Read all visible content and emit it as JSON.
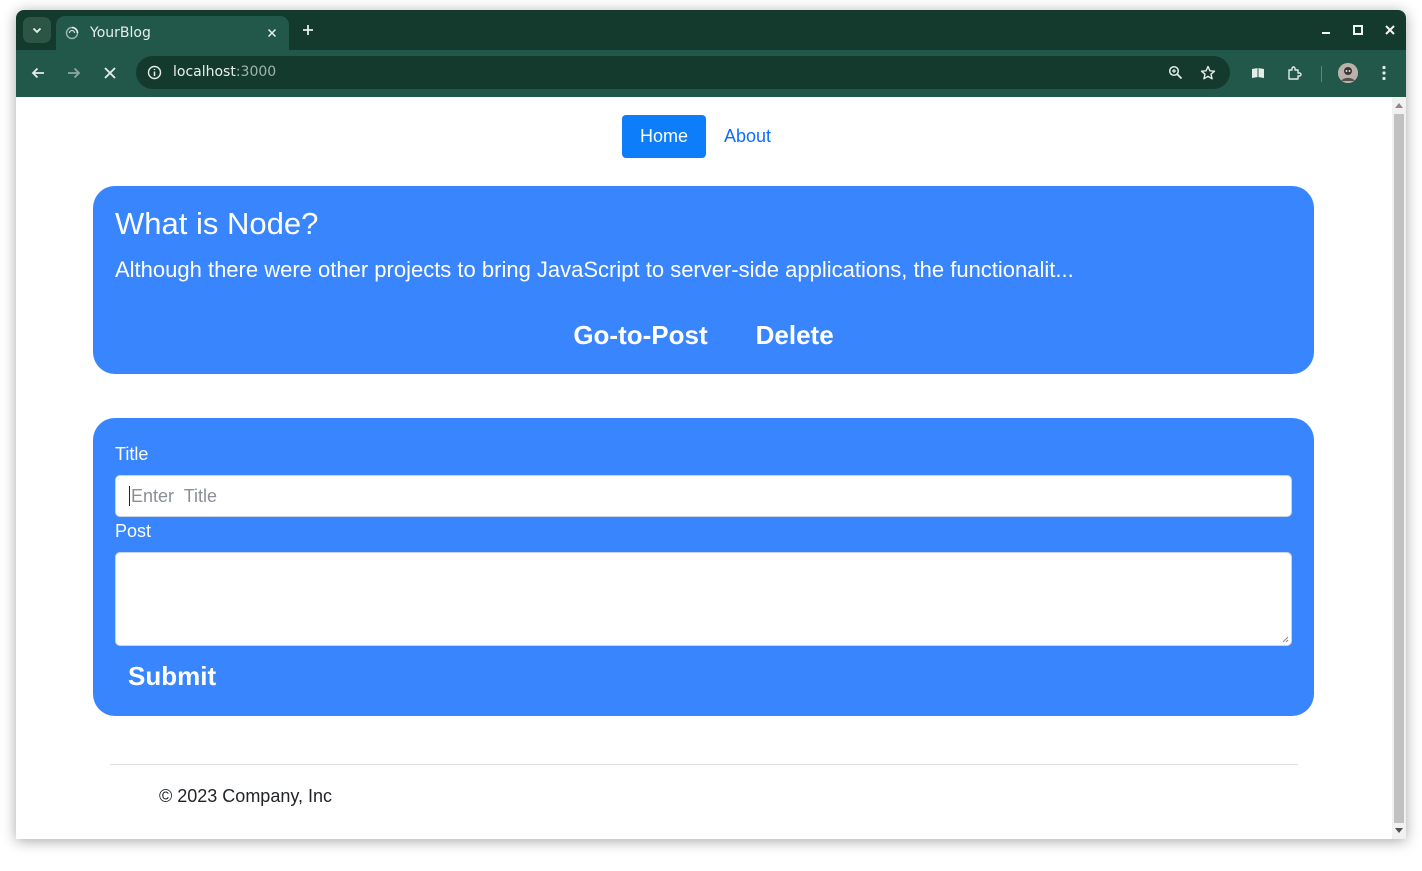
{
  "browser": {
    "tab_title": "YourBlog",
    "url_host": "localhost",
    "url_port": ":3000"
  },
  "nav": {
    "items": [
      {
        "label": "Home",
        "active": true
      },
      {
        "label": "About",
        "active": false
      }
    ]
  },
  "post": {
    "title": "What is Node?",
    "excerpt": "Although there were other projects to bring JavaScript to server-side applications, the functionalit...",
    "go_label": "Go-to-Post",
    "delete_label": "Delete"
  },
  "form": {
    "title_label": "Title",
    "title_placeholder": "Enter  Title",
    "post_label": "Post",
    "submit_label": "Submit"
  },
  "footer": {
    "text": "© 2023 Company, Inc"
  },
  "colors": {
    "card_bg": "#3885fd",
    "nav_active": "#0d7dfa",
    "nav_link": "#0d6efd",
    "browser_frame": "#143a2d",
    "browser_toolbar": "#22584a"
  }
}
